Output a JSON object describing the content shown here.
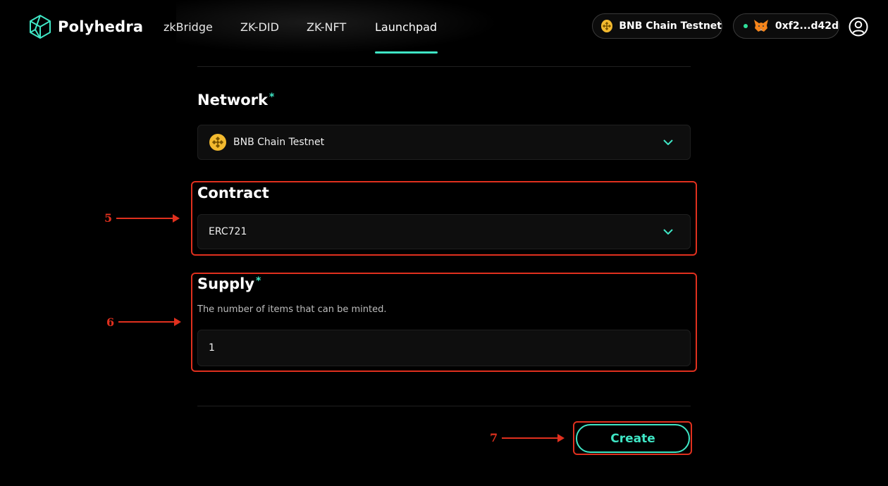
{
  "header": {
    "brand": "Polyhedra",
    "nav": [
      "zkBridge",
      "ZK-DID",
      "ZK-NFT",
      "Launchpad"
    ],
    "active_nav": "Launchpad",
    "network_pill": "BNB Chain Testnet",
    "wallet_address": "0xf2...d42d",
    "accent_color": "#3fe6c5"
  },
  "form": {
    "network": {
      "label": "Network",
      "required_mark": "*",
      "value": "BNB Chain Testnet"
    },
    "contract": {
      "label": "Contract",
      "value": "ERC721"
    },
    "supply": {
      "label": "Supply",
      "required_mark": "*",
      "helper": "The number of items that can be minted.",
      "value": "1"
    },
    "submit_label": "Create"
  },
  "annotations": {
    "step5": "5",
    "step6": "6",
    "step7": "7",
    "color": "#e0301e"
  }
}
